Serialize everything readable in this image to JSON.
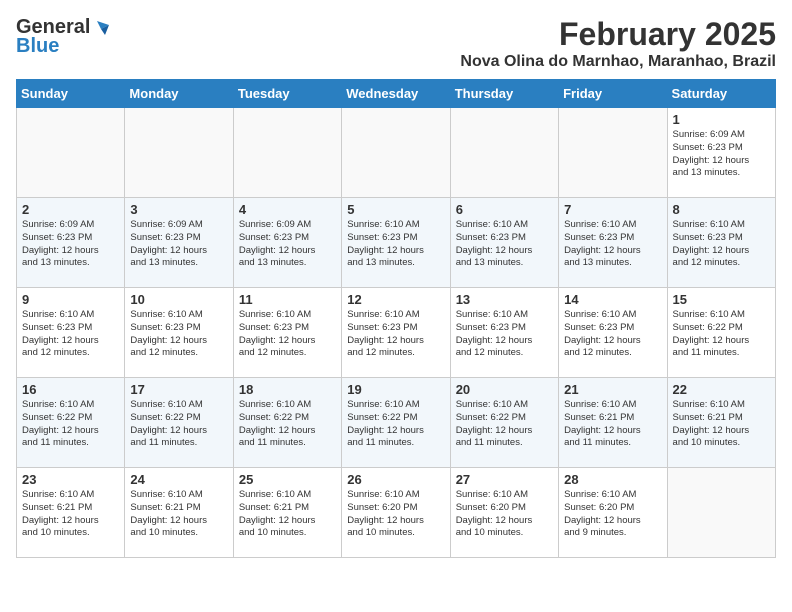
{
  "logo": {
    "general": "General",
    "blue": "Blue"
  },
  "header": {
    "month": "February 2025",
    "location": "Nova Olina do Marnhao, Maranhao, Brazil"
  },
  "weekdays": [
    "Sunday",
    "Monday",
    "Tuesday",
    "Wednesday",
    "Thursday",
    "Friday",
    "Saturday"
  ],
  "weeks": [
    [
      {
        "day": "",
        "info": ""
      },
      {
        "day": "",
        "info": ""
      },
      {
        "day": "",
        "info": ""
      },
      {
        "day": "",
        "info": ""
      },
      {
        "day": "",
        "info": ""
      },
      {
        "day": "",
        "info": ""
      },
      {
        "day": "1",
        "info": "Sunrise: 6:09 AM\nSunset: 6:23 PM\nDaylight: 12 hours\nand 13 minutes."
      }
    ],
    [
      {
        "day": "2",
        "info": "Sunrise: 6:09 AM\nSunset: 6:23 PM\nDaylight: 12 hours\nand 13 minutes."
      },
      {
        "day": "3",
        "info": "Sunrise: 6:09 AM\nSunset: 6:23 PM\nDaylight: 12 hours\nand 13 minutes."
      },
      {
        "day": "4",
        "info": "Sunrise: 6:09 AM\nSunset: 6:23 PM\nDaylight: 12 hours\nand 13 minutes."
      },
      {
        "day": "5",
        "info": "Sunrise: 6:10 AM\nSunset: 6:23 PM\nDaylight: 12 hours\nand 13 minutes."
      },
      {
        "day": "6",
        "info": "Sunrise: 6:10 AM\nSunset: 6:23 PM\nDaylight: 12 hours\nand 13 minutes."
      },
      {
        "day": "7",
        "info": "Sunrise: 6:10 AM\nSunset: 6:23 PM\nDaylight: 12 hours\nand 13 minutes."
      },
      {
        "day": "8",
        "info": "Sunrise: 6:10 AM\nSunset: 6:23 PM\nDaylight: 12 hours\nand 12 minutes."
      }
    ],
    [
      {
        "day": "9",
        "info": "Sunrise: 6:10 AM\nSunset: 6:23 PM\nDaylight: 12 hours\nand 12 minutes."
      },
      {
        "day": "10",
        "info": "Sunrise: 6:10 AM\nSunset: 6:23 PM\nDaylight: 12 hours\nand 12 minutes."
      },
      {
        "day": "11",
        "info": "Sunrise: 6:10 AM\nSunset: 6:23 PM\nDaylight: 12 hours\nand 12 minutes."
      },
      {
        "day": "12",
        "info": "Sunrise: 6:10 AM\nSunset: 6:23 PM\nDaylight: 12 hours\nand 12 minutes."
      },
      {
        "day": "13",
        "info": "Sunrise: 6:10 AM\nSunset: 6:23 PM\nDaylight: 12 hours\nand 12 minutes."
      },
      {
        "day": "14",
        "info": "Sunrise: 6:10 AM\nSunset: 6:23 PM\nDaylight: 12 hours\nand 12 minutes."
      },
      {
        "day": "15",
        "info": "Sunrise: 6:10 AM\nSunset: 6:22 PM\nDaylight: 12 hours\nand 11 minutes."
      }
    ],
    [
      {
        "day": "16",
        "info": "Sunrise: 6:10 AM\nSunset: 6:22 PM\nDaylight: 12 hours\nand 11 minutes."
      },
      {
        "day": "17",
        "info": "Sunrise: 6:10 AM\nSunset: 6:22 PM\nDaylight: 12 hours\nand 11 minutes."
      },
      {
        "day": "18",
        "info": "Sunrise: 6:10 AM\nSunset: 6:22 PM\nDaylight: 12 hours\nand 11 minutes."
      },
      {
        "day": "19",
        "info": "Sunrise: 6:10 AM\nSunset: 6:22 PM\nDaylight: 12 hours\nand 11 minutes."
      },
      {
        "day": "20",
        "info": "Sunrise: 6:10 AM\nSunset: 6:22 PM\nDaylight: 12 hours\nand 11 minutes."
      },
      {
        "day": "21",
        "info": "Sunrise: 6:10 AM\nSunset: 6:21 PM\nDaylight: 12 hours\nand 11 minutes."
      },
      {
        "day": "22",
        "info": "Sunrise: 6:10 AM\nSunset: 6:21 PM\nDaylight: 12 hours\nand 10 minutes."
      }
    ],
    [
      {
        "day": "23",
        "info": "Sunrise: 6:10 AM\nSunset: 6:21 PM\nDaylight: 12 hours\nand 10 minutes."
      },
      {
        "day": "24",
        "info": "Sunrise: 6:10 AM\nSunset: 6:21 PM\nDaylight: 12 hours\nand 10 minutes."
      },
      {
        "day": "25",
        "info": "Sunrise: 6:10 AM\nSunset: 6:21 PM\nDaylight: 12 hours\nand 10 minutes."
      },
      {
        "day": "26",
        "info": "Sunrise: 6:10 AM\nSunset: 6:20 PM\nDaylight: 12 hours\nand 10 minutes."
      },
      {
        "day": "27",
        "info": "Sunrise: 6:10 AM\nSunset: 6:20 PM\nDaylight: 12 hours\nand 10 minutes."
      },
      {
        "day": "28",
        "info": "Sunrise: 6:10 AM\nSunset: 6:20 PM\nDaylight: 12 hours\nand 9 minutes."
      },
      {
        "day": "",
        "info": ""
      }
    ]
  ],
  "colors": {
    "header_bg": "#2a7fc1",
    "header_text": "#ffffff",
    "stripe_bg": "#f2f7fb"
  }
}
